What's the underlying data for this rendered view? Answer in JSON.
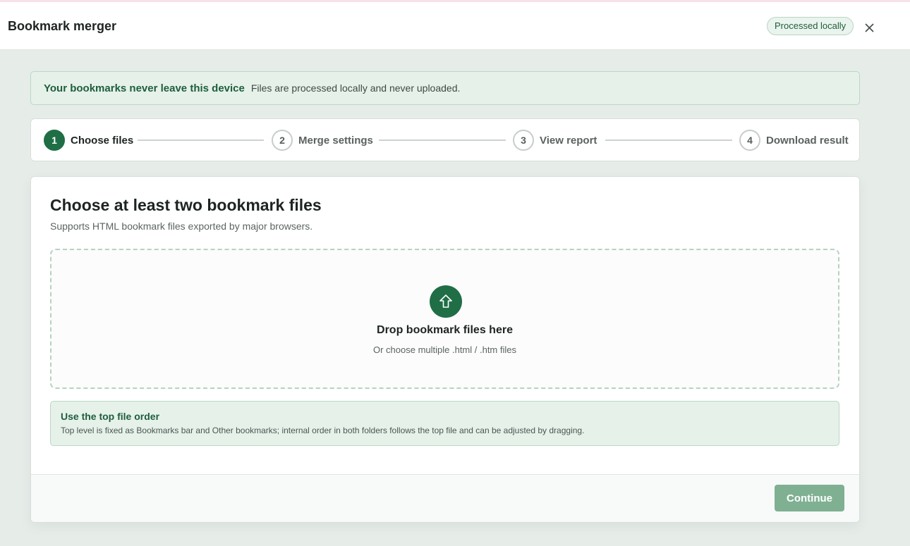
{
  "header": {
    "title": "Bookmark merger",
    "badge": "Processed locally",
    "close_icon": "close-icon"
  },
  "notice": {
    "title": "Your bookmarks never leave this device",
    "text": "Files are processed locally and never uploaded."
  },
  "stepper": {
    "active_index": 0,
    "steps": [
      {
        "num": "1",
        "label": "Choose files"
      },
      {
        "num": "2",
        "label": "Merge settings"
      },
      {
        "num": "3",
        "label": "View report"
      },
      {
        "num": "4",
        "label": "Download result"
      }
    ]
  },
  "card": {
    "title": "Choose at least two bookmark files",
    "subtitle": "Supports HTML bookmark files exported by major browsers.",
    "dropzone": {
      "icon": "upload-arrow-icon",
      "title": "Drop bookmark files here",
      "subtitle": "Or choose multiple .html / .htm files"
    },
    "info": {
      "title": "Use the top file order",
      "text": "Top level is fixed as Bookmarks bar and Other bookmarks; internal order in both folders follows the top file and can be adjusted by dragging."
    },
    "continue_label": "Continue"
  },
  "colors": {
    "accent": "#1f6e46",
    "accent_light": "#e6f1ea",
    "button_disabled": "#7fb092"
  }
}
